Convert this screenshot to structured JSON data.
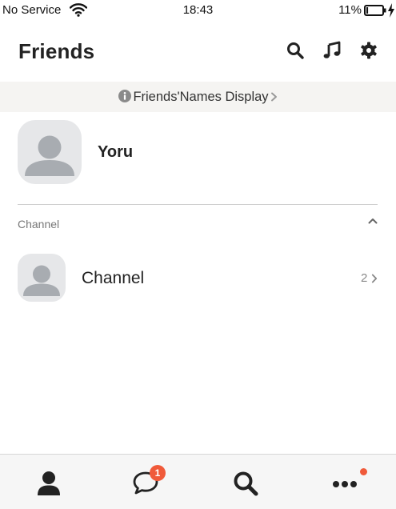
{
  "status_bar": {
    "carrier": "No Service",
    "time": "18:43",
    "battery_percent": "11%",
    "battery_level": 0.11,
    "icons": [
      "wifi-icon",
      "battery-icon",
      "charging-icon"
    ]
  },
  "header": {
    "title": "Friends",
    "icons": [
      "search-icon",
      "music-note-icon",
      "gear-icon"
    ]
  },
  "banner": {
    "text": "Friends'Names Display",
    "icons": [
      "info-icon",
      "chevron-right-icon"
    ]
  },
  "profile": {
    "name": "Yoru",
    "avatar_icon": "default-avatar-icon"
  },
  "channel_section": {
    "label": "Channel",
    "collapse_icon": "chevron-up-icon",
    "items": [
      {
        "label": "Channel",
        "count": "2",
        "avatar_icon": "default-avatar-icon"
      }
    ]
  },
  "bottom_nav": {
    "items": [
      {
        "name": "friends",
        "icon": "person-icon"
      },
      {
        "name": "chats",
        "icon": "chat-bubble-icon",
        "badge": "1"
      },
      {
        "name": "search",
        "icon": "search-icon"
      },
      {
        "name": "more",
        "icon": "more-dots-icon",
        "has_dot": true
      }
    ]
  },
  "colors": {
    "text": "#222222",
    "banner_bg": "#f5f4f2",
    "avatar_bg": "#e6e7e9",
    "avatar_fg": "#a8acb1",
    "badge": "#f05a3a",
    "nav_bg": "#f6f6f6"
  }
}
